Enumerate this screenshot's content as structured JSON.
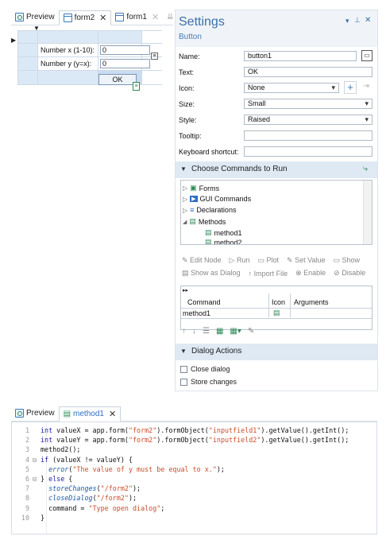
{
  "top_tabs": [
    {
      "label": "Preview",
      "icon": "preview-icon"
    },
    {
      "label": "form2",
      "icon": "form-icon",
      "close": "✕"
    },
    {
      "label": "form1",
      "icon": "form-icon",
      "close": "✕"
    }
  ],
  "form": {
    "field1_label": "Number x (1-10):",
    "field1_value": "0",
    "field2_label": "Number y (y=x):",
    "field2_value": "0",
    "button_label": "OK"
  },
  "settings": {
    "title": "Settings",
    "subtitle": "Button",
    "header_icons": [
      "▾",
      "⚲",
      "✕"
    ],
    "properties": [
      {
        "label": "Name:",
        "value": "button1"
      },
      {
        "label": "Text:",
        "value": "OK"
      },
      {
        "label": "Icon:",
        "value": "None"
      },
      {
        "label": "Size:",
        "value": "Small"
      },
      {
        "label": "Style:",
        "value": "Raised"
      },
      {
        "label": "Tooltip:",
        "value": ""
      },
      {
        "label": "Keyboard shortcut:",
        "value": ""
      }
    ],
    "commands_section": "Choose Commands to Run",
    "tree": [
      {
        "label": "Forms",
        "expander": "▷"
      },
      {
        "label": "GUI Commands",
        "expander": "▷"
      },
      {
        "label": "Declarations",
        "expander": "▷"
      },
      {
        "label": "Methods",
        "expander": "◢"
      },
      {
        "label": "method1",
        "expander": ""
      },
      {
        "label": "method2",
        "expander": ""
      }
    ],
    "toolbar1": [
      "Edit Node",
      "Run",
      "Plot",
      "Set Value",
      "Show"
    ],
    "toolbar2": [
      "Show as Dialog",
      "Import File",
      "Enable",
      "Disable"
    ],
    "table_headers": [
      "Command",
      "Icon",
      "Arguments"
    ],
    "table_rows": [
      {
        "command": "method1"
      }
    ],
    "dialog_section": "Dialog Actions",
    "dialog_options": [
      {
        "label": "Close dialog",
        "checked": false
      },
      {
        "label": "Store changes",
        "checked": false
      }
    ]
  },
  "editor_tabs": [
    {
      "label": "Preview"
    },
    {
      "label": "method1",
      "close": "✕"
    }
  ],
  "code_lines": [
    {
      "n": "1",
      "fold": "",
      "text": "int valueX = app.form(\"form2\").formObject(\"inputfield1\").getValue().getInt();"
    },
    {
      "n": "2",
      "fold": "",
      "text": "int valueY = app.form(\"form2\").formObject(\"inputfield2\").getValue().getInt();"
    },
    {
      "n": "3",
      "fold": "",
      "text": "method2();"
    },
    {
      "n": "4",
      "fold": "⊟",
      "text": "if (valueX != valueY) {"
    },
    {
      "n": "5",
      "fold": "",
      "text": "  error(\"The value of y must be equal to x.\");"
    },
    {
      "n": "6",
      "fold": "⊟",
      "text": "} else {"
    },
    {
      "n": "7",
      "fold": "",
      "text": "  storeChanges(\"/form2\");"
    },
    {
      "n": "8",
      "fold": "",
      "text": "  closeDialog(\"/form2\");"
    },
    {
      "n": "9",
      "fold": "",
      "text": "  command = \"Type open dialog\";"
    },
    {
      "n": "10",
      "fold": "",
      "text": "}"
    }
  ],
  "colors": {
    "accent": "#3c6fa8",
    "section_bg": "#dfe9f4",
    "grid_cell": "#dbe9f7",
    "keyword": "#1a1aa6",
    "string": "#c84d27"
  }
}
